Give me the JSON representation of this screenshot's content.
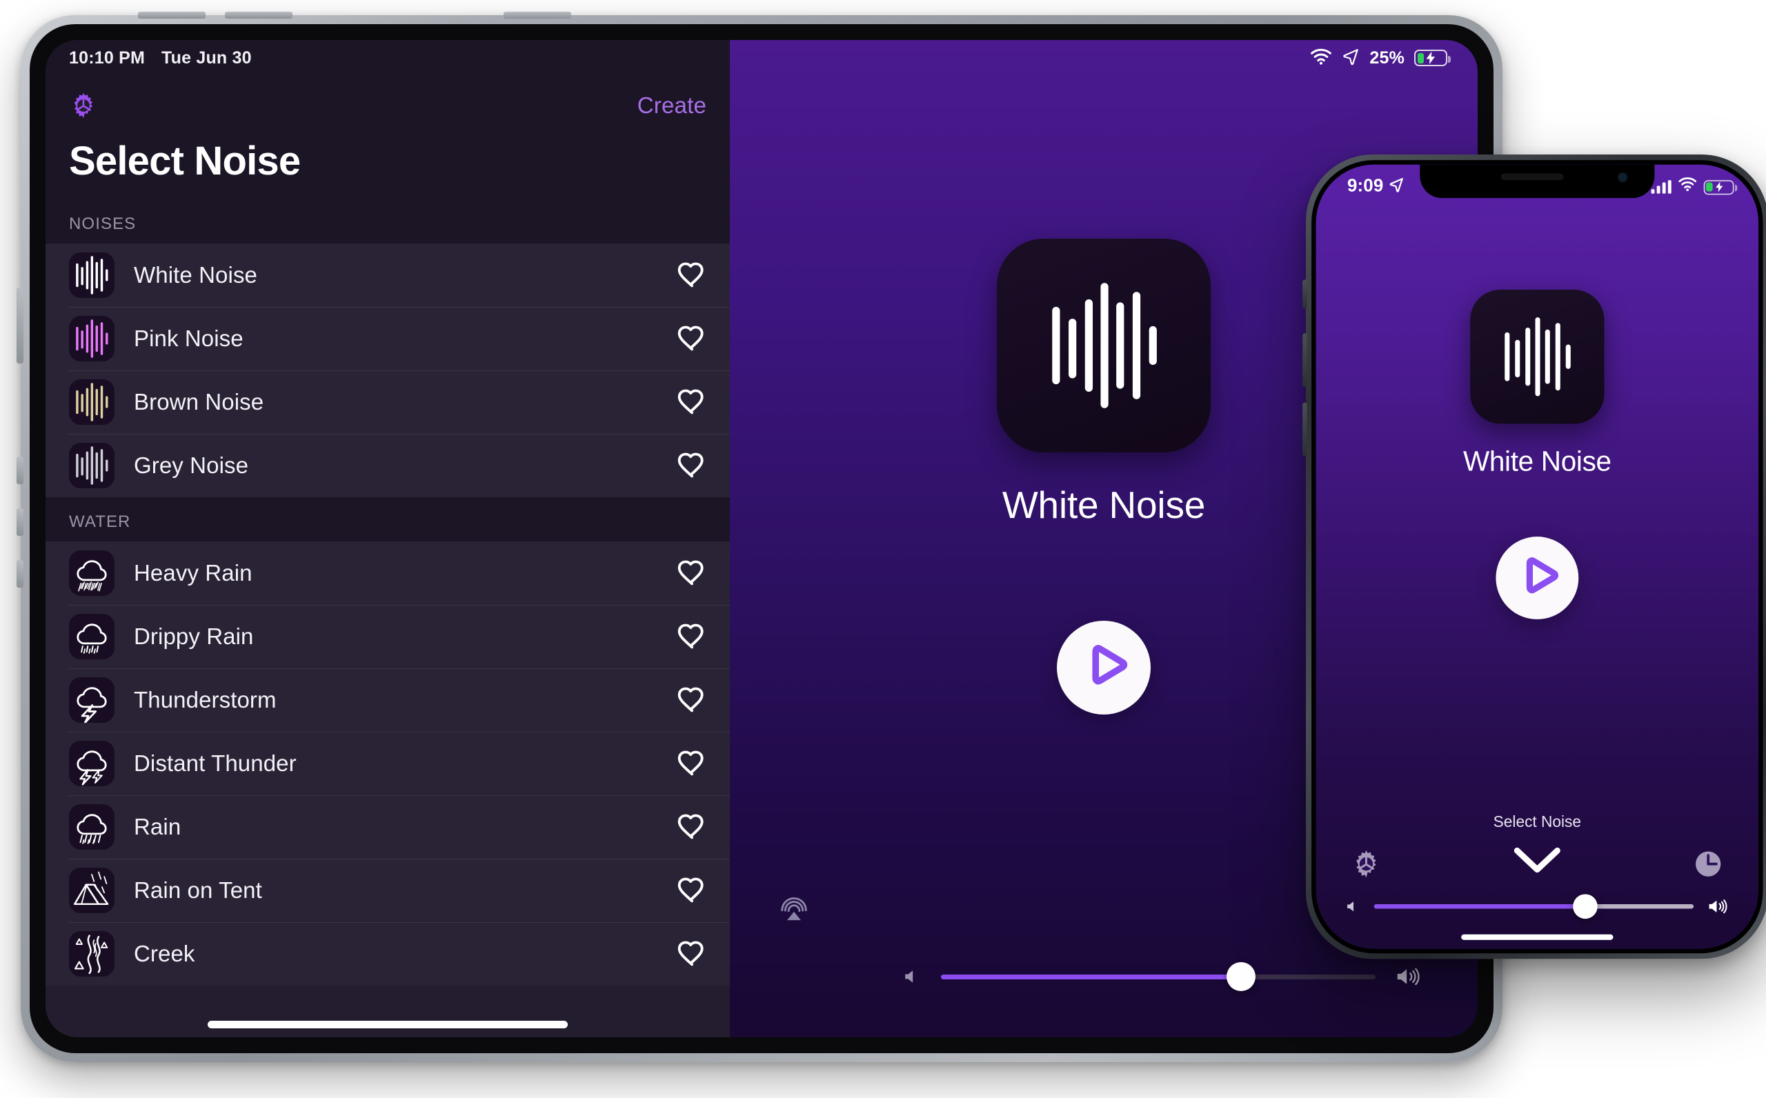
{
  "ipad": {
    "statusbar": {
      "time": "10:10 PM",
      "date": "Tue Jun 30",
      "battery_pct": "25%"
    },
    "sidebar": {
      "gear_icon": "gear-icon",
      "create_label": "Create",
      "title": "Select Noise",
      "sections": [
        {
          "header": "NOISES",
          "items": [
            {
              "label": "White Noise",
              "icon": "waveform-icon",
              "wave_color": "#ffffff",
              "favorite": false
            },
            {
              "label": "Pink Noise",
              "icon": "waveform-icon",
              "wave_color": "#e879f9",
              "favorite": false
            },
            {
              "label": "Brown Noise",
              "icon": "waveform-icon",
              "wave_color": "#ddd0a0",
              "favorite": false
            },
            {
              "label": "Grey Noise",
              "icon": "waveform-icon",
              "wave_color": "#cfcfd6",
              "favorite": false
            }
          ]
        },
        {
          "header": "WATER",
          "items": [
            {
              "label": "Heavy Rain",
              "icon": "cloud-heavy-rain-icon",
              "wave_color": "#ffffff",
              "favorite": false
            },
            {
              "label": "Drippy Rain",
              "icon": "cloud-drizzle-icon",
              "wave_color": "#ffffff",
              "favorite": false
            },
            {
              "label": "Thunderstorm",
              "icon": "cloud-bolt-icon",
              "wave_color": "#ffffff",
              "favorite": false
            },
            {
              "label": "Distant Thunder",
              "icon": "cloud-bolt-distant-icon",
              "wave_color": "#ffffff",
              "favorite": false
            },
            {
              "label": "Rain",
              "icon": "cloud-rain-icon",
              "wave_color": "#ffffff",
              "favorite": false
            },
            {
              "label": "Rain on Tent",
              "icon": "tent-rain-icon",
              "wave_color": "#ffffff",
              "favorite": false
            },
            {
              "label": "Creek",
              "icon": "creek-stream-icon",
              "wave_color": "#ffffff",
              "favorite": false
            }
          ]
        }
      ]
    },
    "detail": {
      "app_icon": "waveform-icon",
      "title": "White Noise",
      "play_label": "play-icon",
      "airplay_label": "airplay-icon",
      "volume_percent": 69
    }
  },
  "iphone": {
    "statusbar": {
      "time": "9:09"
    },
    "detail": {
      "app_icon": "waveform-icon",
      "title": "White Noise",
      "play_label": "play-icon",
      "select_label": "Select Noise",
      "chevron_label": "chevron-down-icon",
      "gear_label": "gear-icon",
      "timer_label": "timer-icon",
      "volume_percent": 66
    }
  },
  "colors": {
    "accent_purple": "#8b4ef0",
    "link_purple": "#a96fe8",
    "sidebar_bg": "#241d30",
    "row_bg": "#2a2336",
    "section_bg": "#1c1526",
    "icon_tile_bg": "#180d22",
    "battery_green": "#30d158"
  },
  "waveform_bars": [
    {
      "h": 52,
      "y": 24
    },
    {
      "h": 40,
      "y": 32
    },
    {
      "h": 62,
      "y": 19
    },
    {
      "h": 84,
      "y": 8
    },
    {
      "h": 58,
      "y": 21
    },
    {
      "h": 72,
      "y": 14
    },
    {
      "h": 26,
      "y": 37
    }
  ]
}
